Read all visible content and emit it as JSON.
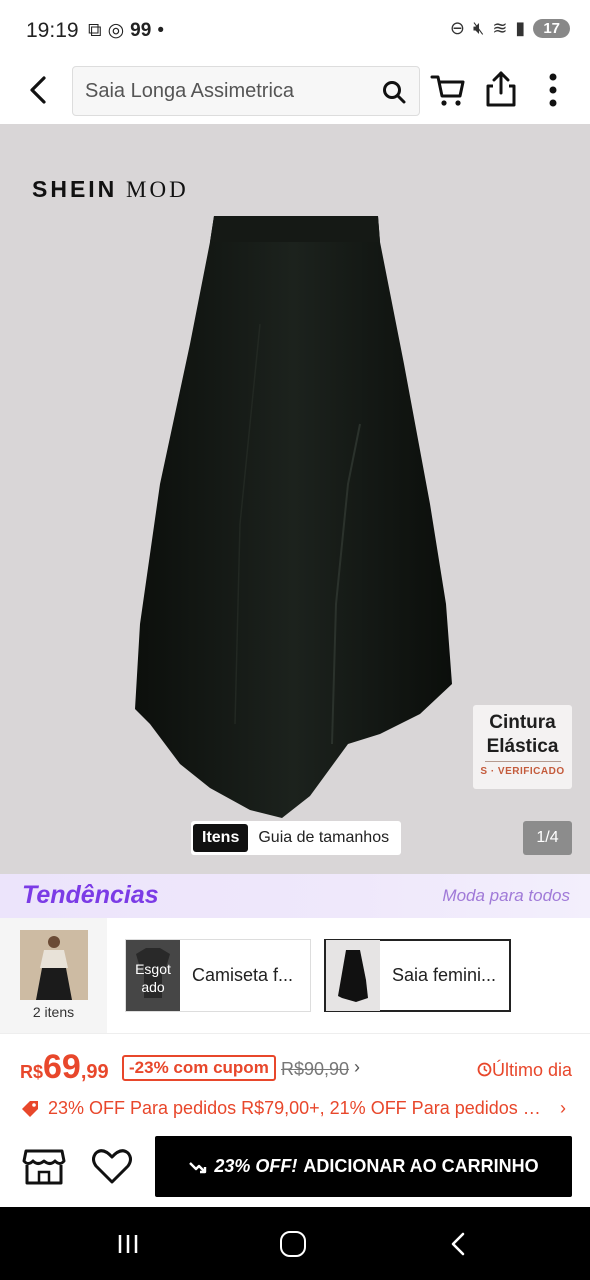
{
  "status_bar": {
    "time": "19:19",
    "notification_count": "99",
    "battery": "17"
  },
  "header": {
    "search_value": "Saia Longa Assimetrica"
  },
  "product_image": {
    "brand_a": "SHEIN",
    "brand_b": "MOD",
    "badge_title_line1": "Cintura",
    "badge_title_line2": "Elástica",
    "badge_sub": "S · VERIFICADO",
    "tab_items": "Itens",
    "tab_size_guide": "Guia de tamanhos",
    "page_counter": "1/4"
  },
  "trends": {
    "title": "Tendências",
    "subtitle": "Moda para todos"
  },
  "variants": {
    "count_label": "2 itens",
    "items": [
      {
        "label": "Camiseta f...",
        "soldout_label": "Esgot ado"
      },
      {
        "label": "Saia femini..."
      }
    ]
  },
  "price": {
    "currency": "R$",
    "integer": "69",
    "decimals": ",99",
    "coupon": "-23% com cupom",
    "old_price": "R$90,90",
    "last_day": "Último dia",
    "promo": "23% OFF Para pedidos R$79,00+,  21% OFF Para pedidos R$..."
  },
  "actions": {
    "add_to_cart_discount": "23% OFF!",
    "add_to_cart_label": "ADICIONAR AO CARRINHO"
  },
  "colors": {
    "accent": "#e8472b",
    "trends_purple": "#7b3be6",
    "button_black": "#000000"
  }
}
